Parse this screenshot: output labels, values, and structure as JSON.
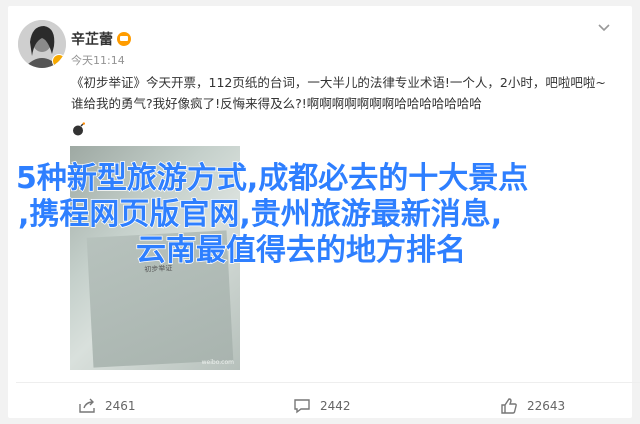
{
  "post": {
    "username": "辛芷蕾",
    "timestamp": "今天11:14",
    "text": "《初步举证》今天开票，112页纸的台词，一大半儿的法律专业术语!一个人，2小时，吧啦吧啦~谁给我的勇气?我好像疯了!反悔来得及么?!啊啊啊啊啊啊啊哈哈哈哈哈哈哈",
    "photo_book_title": "初步举证",
    "photo_watermark": "weibo.com"
  },
  "overlay": {
    "line1": "5种新型旅游方式,成都必去的十大景点",
    "line2": ",携程网页版官网,贵州旅游最新消息,",
    "line3": "云南最值得去的地方排名"
  },
  "actions": {
    "share_count": "2461",
    "comment_count": "2442",
    "like_count": "22643"
  },
  "icons": [
    "avatar",
    "crown-icon",
    "chevron-down-icon",
    "bomb-icon",
    "share-icon",
    "comment-icon",
    "like-icon"
  ],
  "colors": {
    "overlay_text": "#2e7fff",
    "crown": "#ff9c00",
    "verified_badge": "#f7a900"
  }
}
